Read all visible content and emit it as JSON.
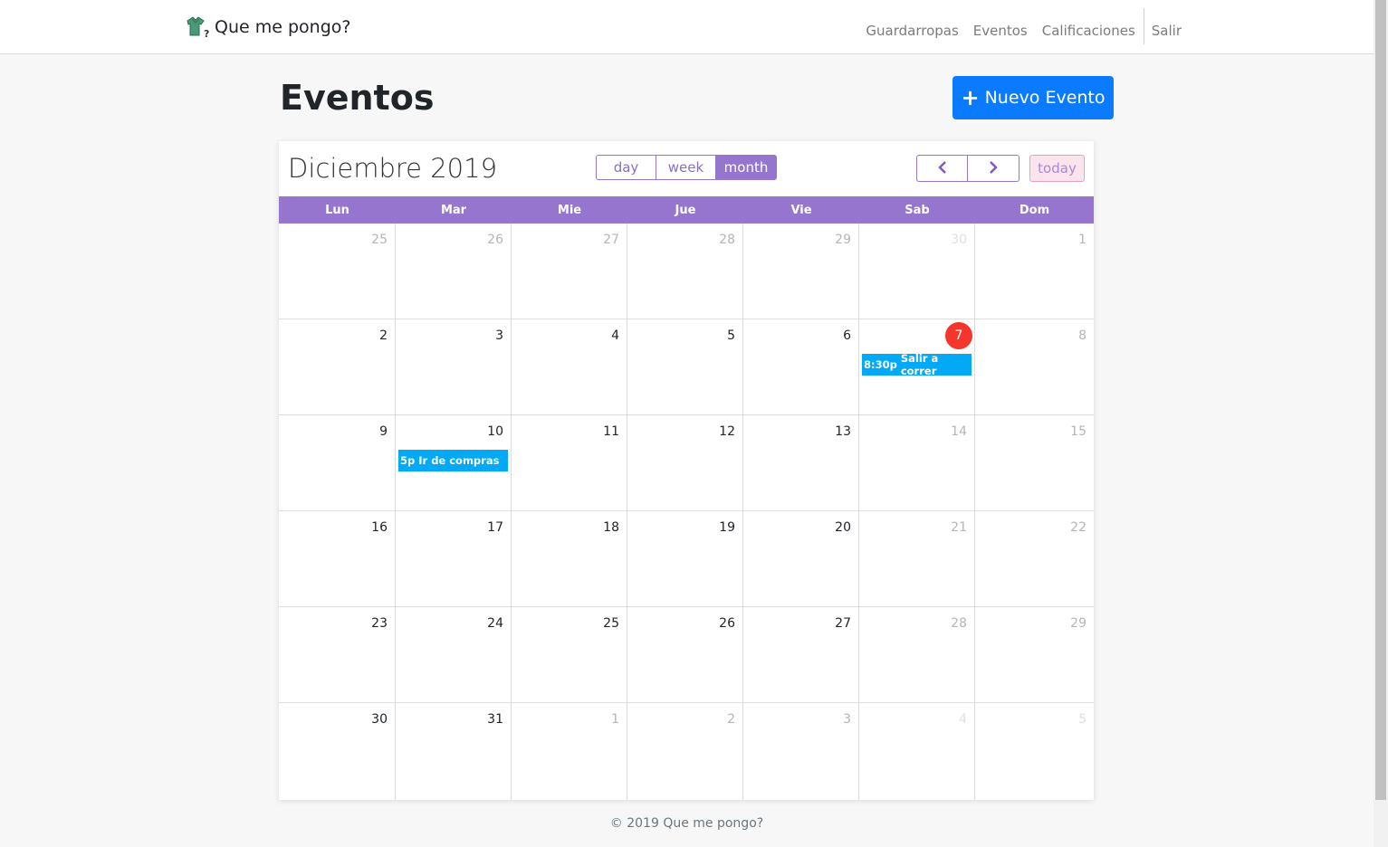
{
  "nav": {
    "brand": "Que me pongo?",
    "links": [
      "Guardarropas",
      "Eventos",
      "Calificaciones"
    ],
    "logout": "Salir"
  },
  "page": {
    "title": "Eventos",
    "new_button": "Nuevo Evento"
  },
  "calendar": {
    "title": "Diciembre 2019",
    "views": {
      "day": "day",
      "week": "week",
      "month": "month",
      "active": "month"
    },
    "today_label": "today",
    "weekdays": [
      "Lun",
      "Mar",
      "Mie",
      "Jue",
      "Vie",
      "Sab",
      "Dom"
    ],
    "weeks": [
      [
        {
          "d": "25",
          "s": "muted"
        },
        {
          "d": "26",
          "s": "muted"
        },
        {
          "d": "27",
          "s": "muted"
        },
        {
          "d": "28",
          "s": "muted"
        },
        {
          "d": "29",
          "s": "muted"
        },
        {
          "d": "30",
          "s": "faint"
        },
        {
          "d": "1",
          "s": "muted"
        }
      ],
      [
        {
          "d": "2",
          "s": "normal"
        },
        {
          "d": "3",
          "s": "normal"
        },
        {
          "d": "4",
          "s": "normal"
        },
        {
          "d": "5",
          "s": "normal"
        },
        {
          "d": "6",
          "s": "normal"
        },
        {
          "d": "7",
          "s": "today",
          "event": {
            "time": "8:30p",
            "title": "Salir a correr"
          }
        },
        {
          "d": "8",
          "s": "muted"
        }
      ],
      [
        {
          "d": "9",
          "s": "normal"
        },
        {
          "d": "10",
          "s": "normal",
          "event": {
            "time": "5p",
            "title": "Ir de compras"
          }
        },
        {
          "d": "11",
          "s": "normal"
        },
        {
          "d": "12",
          "s": "normal"
        },
        {
          "d": "13",
          "s": "normal"
        },
        {
          "d": "14",
          "s": "muted"
        },
        {
          "d": "15",
          "s": "muted"
        }
      ],
      [
        {
          "d": "16",
          "s": "normal"
        },
        {
          "d": "17",
          "s": "normal"
        },
        {
          "d": "18",
          "s": "normal"
        },
        {
          "d": "19",
          "s": "normal"
        },
        {
          "d": "20",
          "s": "normal"
        },
        {
          "d": "21",
          "s": "muted"
        },
        {
          "d": "22",
          "s": "muted"
        }
      ],
      [
        {
          "d": "23",
          "s": "normal"
        },
        {
          "d": "24",
          "s": "normal"
        },
        {
          "d": "25",
          "s": "normal"
        },
        {
          "d": "26",
          "s": "normal"
        },
        {
          "d": "27",
          "s": "normal"
        },
        {
          "d": "28",
          "s": "muted"
        },
        {
          "d": "29",
          "s": "muted"
        }
      ],
      [
        {
          "d": "30",
          "s": "normal"
        },
        {
          "d": "31",
          "s": "normal"
        },
        {
          "d": "1",
          "s": "muted"
        },
        {
          "d": "2",
          "s": "muted"
        },
        {
          "d": "3",
          "s": "muted"
        },
        {
          "d": "4",
          "s": "faint"
        },
        {
          "d": "5",
          "s": "faint"
        }
      ]
    ]
  },
  "footer": {
    "text": "© 2019 Que me pongo?"
  },
  "colors": {
    "accent": "#9575cd",
    "event": "#03a9f4",
    "today": "#f4362c",
    "primary_button": "#0a7bff"
  }
}
